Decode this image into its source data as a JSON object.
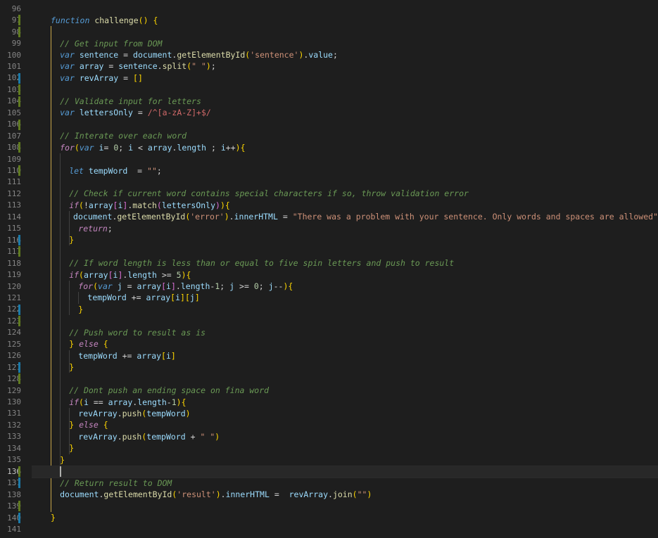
{
  "editor": {
    "lines": [
      {
        "n": "96",
        "t": ""
      },
      {
        "n": "97",
        "t": "function challenge() {"
      },
      {
        "n": "98",
        "t": ""
      },
      {
        "n": "99",
        "t": "// Get input from DOM"
      },
      {
        "n": "100",
        "t": "var sentence = document.getElementById('sentence').value;"
      },
      {
        "n": "101",
        "t": "var array = sentence.split(\" \");"
      },
      {
        "n": "102",
        "t": "var revArray = []"
      },
      {
        "n": "103",
        "t": ""
      },
      {
        "n": "104",
        "t": "// Validate input for letters"
      },
      {
        "n": "105",
        "t": "var lettersOnly = /^[a-zA-Z]+$/"
      },
      {
        "n": "106",
        "t": ""
      },
      {
        "n": "107",
        "t": "// Interate over each word"
      },
      {
        "n": "108",
        "t": "for(var i= 0; i < array.length ; i++){"
      },
      {
        "n": "109",
        "t": ""
      },
      {
        "n": "110",
        "t": "let tempWord  = \"\";"
      },
      {
        "n": "111",
        "t": ""
      },
      {
        "n": "112",
        "t": "// Check if current word contains special characters if so, throw validation error"
      },
      {
        "n": "113",
        "t": "if(!array[i].match(lettersOnly)){"
      },
      {
        "n": "114",
        "t": "document.getElementById('error').innerHTML = \"There was a problem with your sentence. Only words and spaces are allowed\""
      },
      {
        "n": "115",
        "t": "return;"
      },
      {
        "n": "116",
        "t": "}"
      },
      {
        "n": "117",
        "t": ""
      },
      {
        "n": "118",
        "t": "// If word length is less than or equal to five spin letters and push to result"
      },
      {
        "n": "119",
        "t": "if(array[i].length >= 5){"
      },
      {
        "n": "120",
        "t": "for(var j = array[i].length-1; j >= 0; j--){"
      },
      {
        "n": "121",
        "t": "tempWord += array[i][j]"
      },
      {
        "n": "122",
        "t": "}"
      },
      {
        "n": "123",
        "t": ""
      },
      {
        "n": "124",
        "t": "// Push word to result as is"
      },
      {
        "n": "125",
        "t": "} else {"
      },
      {
        "n": "126",
        "t": "tempWord += array[i]"
      },
      {
        "n": "127",
        "t": "}"
      },
      {
        "n": "128",
        "t": ""
      },
      {
        "n": "129",
        "t": "// Dont push an ending space on fina word"
      },
      {
        "n": "130",
        "t": "if(i == array.length-1){"
      },
      {
        "n": "131",
        "t": "revArray.push(tempWord)"
      },
      {
        "n": "132",
        "t": "} else {"
      },
      {
        "n": "133",
        "t": "revArray.push(tempWord + \" \")"
      },
      {
        "n": "134",
        "t": "}"
      },
      {
        "n": "135",
        "t": "}"
      },
      {
        "n": "136",
        "t": ""
      },
      {
        "n": "137",
        "t": "// Return result to DOM"
      },
      {
        "n": "138",
        "t": "document.getElementById('result').innerHTML =  revArray.join(\"\")"
      },
      {
        "n": "139",
        "t": ""
      },
      {
        "n": "140",
        "t": "}"
      },
      {
        "n": "141",
        "t": ""
      }
    ]
  }
}
